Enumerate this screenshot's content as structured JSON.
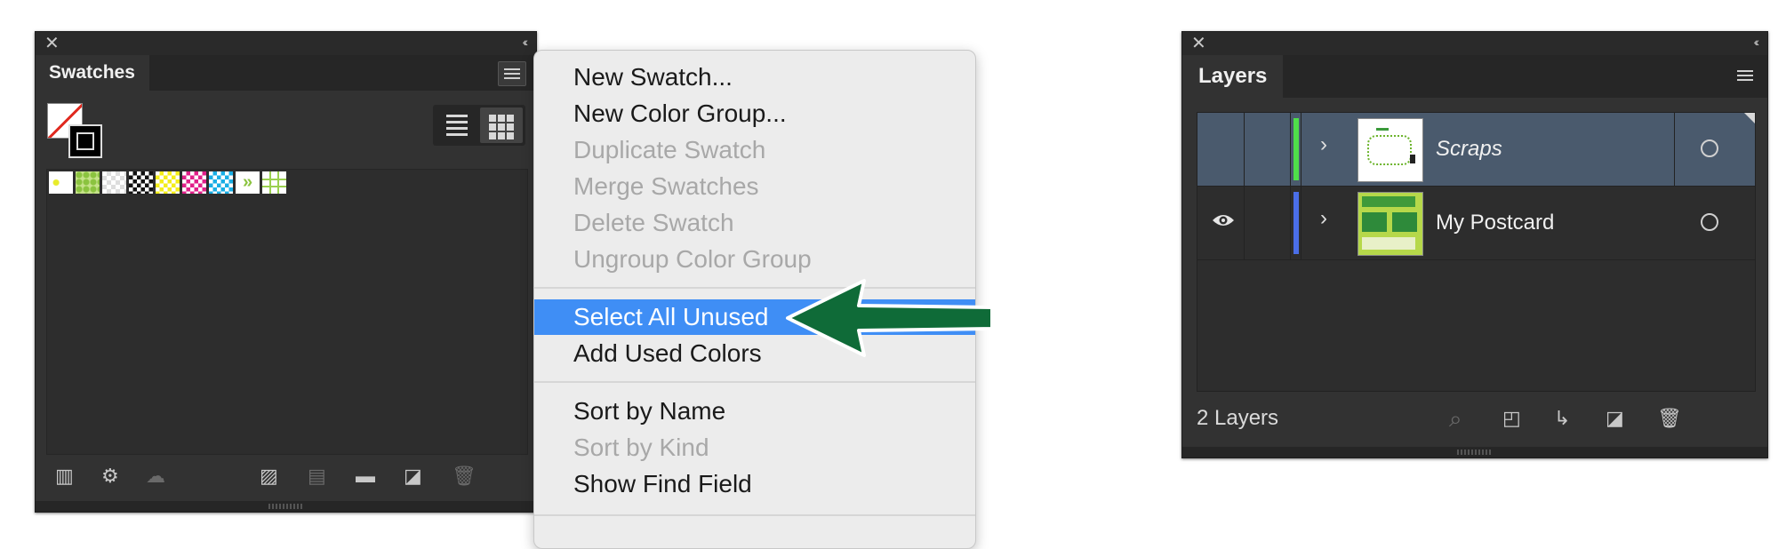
{
  "swatches_panel": {
    "title": "Swatches",
    "close_glyph": "✕",
    "collapse_glyph": "‹‹",
    "footer_icons": [
      "swatch-libraries-icon",
      "show-kinds-icon",
      "cloud-libraries-icon",
      "swatch-options-icon",
      "new-color-group-icon",
      "new-folder-icon",
      "new-swatch-icon",
      "delete-swatch-icon"
    ]
  },
  "context_menu": {
    "items": [
      {
        "label": "New Swatch...",
        "enabled": true
      },
      {
        "label": "New Color Group...",
        "enabled": true
      },
      {
        "label": "Duplicate Swatch",
        "enabled": false
      },
      {
        "label": "Merge Swatches",
        "enabled": false
      },
      {
        "label": "Delete Swatch",
        "enabled": false
      },
      {
        "label": "Ungroup Color Group",
        "enabled": false
      },
      {
        "label": "Select All Unused",
        "enabled": true,
        "selected": true
      },
      {
        "label": "Add Used Colors",
        "enabled": true
      },
      {
        "label": "Sort by Name",
        "enabled": true
      },
      {
        "label": "Sort by Kind",
        "enabled": false
      },
      {
        "label": "Show Find Field",
        "enabled": true
      }
    ]
  },
  "annotation": {
    "arrow_color": "#0f6b38"
  },
  "layers_panel": {
    "title": "Layers",
    "close_glyph": "✕",
    "collapse_glyph": "‹‹",
    "layers": [
      {
        "name": "Scraps",
        "color": "#4fe04a",
        "visible": false,
        "selected": true,
        "italic": true
      },
      {
        "name": "My Postcard",
        "color": "#4a6ee8",
        "visible": true,
        "selected": false,
        "italic": false
      }
    ],
    "count_label": "2 Layers"
  },
  "colors": {
    "selection": "#3f8ef5",
    "panel_bg": "#323232",
    "menu_bg": "#ececec"
  }
}
